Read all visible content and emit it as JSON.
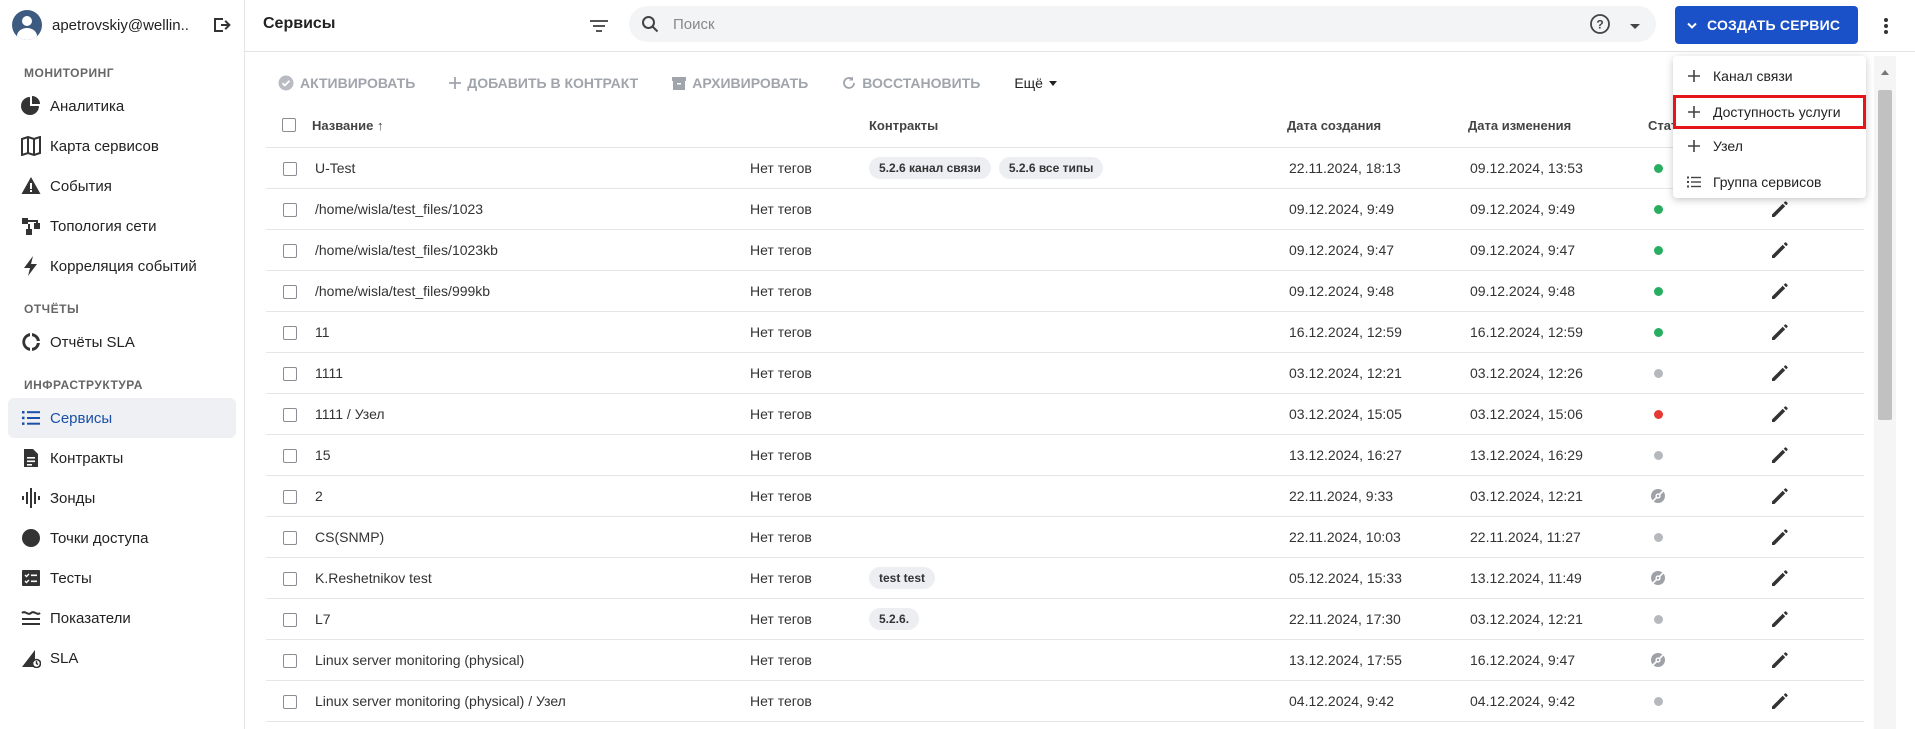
{
  "sidebar": {
    "user": "apetrovskiy@wellin...",
    "sections": [
      {
        "title": "МОНИТОРИНГ",
        "items": [
          {
            "label": "Аналитика",
            "icon": "pie-chart-icon"
          },
          {
            "label": "Карта сервисов",
            "icon": "map-icon"
          },
          {
            "label": "События",
            "icon": "warning-icon"
          },
          {
            "label": "Топология сети",
            "icon": "topology-icon"
          },
          {
            "label": "Корреляция событий",
            "icon": "lightning-icon"
          }
        ]
      },
      {
        "title": "ОТЧЁТЫ",
        "items": [
          {
            "label": "Отчёты SLA",
            "icon": "donut-icon"
          }
        ]
      },
      {
        "title": "ИНФРАСТРУКТУРА",
        "items": [
          {
            "label": "Сервисы",
            "icon": "list-icon",
            "active": true
          },
          {
            "label": "Контракты",
            "icon": "document-icon"
          },
          {
            "label": "Зонды",
            "icon": "sound-wave-icon"
          },
          {
            "label": "Точки доступа",
            "icon": "circle-icon"
          },
          {
            "label": "Тесты",
            "icon": "checklist-icon"
          },
          {
            "label": "Показатели",
            "icon": "metrics-icon"
          },
          {
            "label": "SLA",
            "icon": "sla-icon"
          }
        ]
      }
    ]
  },
  "header": {
    "title": "Сервисы",
    "search_placeholder": "Поиск",
    "create_button": "СОЗДАТЬ СЕРВИС"
  },
  "toolbar": {
    "activate": "АКТИВИРОВАТЬ",
    "add_to_contract": "ДОБАВИТЬ В КОНТРАКТ",
    "archive": "АРХИВИРОВАТЬ",
    "restore": "ВОССТАНОВИТЬ",
    "more": "Ещё"
  },
  "table": {
    "columns": {
      "name": "Название ↑",
      "contracts": "Контракты",
      "created": "Дата создания",
      "modified": "Дата изменения",
      "status": "Стат"
    },
    "rows": [
      {
        "name": "U-Test",
        "tags": "Нет тегов",
        "contracts": [
          "5.2.6 канал связи",
          "5.2.6 все типы"
        ],
        "created": "22.11.2024, 18:13",
        "modified": "09.12.2024, 13:53",
        "status": "green"
      },
      {
        "name": "/home/wisla/test_files/1023",
        "tags": "Нет тегов",
        "contracts": [],
        "created": "09.12.2024, 9:49",
        "modified": "09.12.2024, 9:49",
        "status": "green"
      },
      {
        "name": "/home/wisla/test_files/1023kb",
        "tags": "Нет тегов",
        "contracts": [],
        "created": "09.12.2024, 9:47",
        "modified": "09.12.2024, 9:47",
        "status": "green"
      },
      {
        "name": "/home/wisla/test_files/999kb",
        "tags": "Нет тегов",
        "contracts": [],
        "created": "09.12.2024, 9:48",
        "modified": "09.12.2024, 9:48",
        "status": "green"
      },
      {
        "name": "11",
        "tags": "Нет тегов",
        "contracts": [],
        "created": "16.12.2024, 12:59",
        "modified": "16.12.2024, 12:59",
        "status": "green"
      },
      {
        "name": "1111",
        "tags": "Нет тегов",
        "contracts": [],
        "created": "03.12.2024, 12:21",
        "modified": "03.12.2024, 12:26",
        "status": "gray"
      },
      {
        "name": "1111 / Узел",
        "tags": "Нет тегов",
        "contracts": [],
        "created": "03.12.2024, 15:05",
        "modified": "03.12.2024, 15:06",
        "status": "red"
      },
      {
        "name": "15",
        "tags": "Нет тегов",
        "contracts": [],
        "created": "13.12.2024, 16:27",
        "modified": "13.12.2024, 16:29",
        "status": "gray"
      },
      {
        "name": "2",
        "tags": "Нет тегов",
        "contracts": [],
        "created": "22.11.2024, 9:33",
        "modified": "03.12.2024, 12:21",
        "status": "off"
      },
      {
        "name": "CS(SNMP)",
        "tags": "Нет тегов",
        "contracts": [],
        "created": "22.11.2024, 10:03",
        "modified": "22.11.2024, 11:27",
        "status": "gray"
      },
      {
        "name": "K.Reshetnikov test",
        "tags": "Нет тегов",
        "contracts": [
          "test test"
        ],
        "created": "05.12.2024, 15:33",
        "modified": "13.12.2024, 11:49",
        "status": "off"
      },
      {
        "name": "L7",
        "tags": "Нет тегов",
        "contracts": [
          "5.2.6."
        ],
        "created": "22.11.2024, 17:30",
        "modified": "03.12.2024, 12:21",
        "status": "gray"
      },
      {
        "name": "Linux server monitoring (physical)",
        "tags": "Нет тегов",
        "contracts": [],
        "created": "13.12.2024, 17:55",
        "modified": "16.12.2024, 9:47",
        "status": "off"
      },
      {
        "name": "Linux server monitoring (physical) / Узел",
        "tags": "Нет тегов",
        "contracts": [],
        "created": "04.12.2024, 9:42",
        "modified": "04.12.2024, 9:42",
        "status": "gray"
      }
    ]
  },
  "menu": {
    "items": [
      {
        "label": "Канал связи",
        "icon": "plus-icon"
      },
      {
        "label": "Доступность услуги",
        "icon": "plus-icon",
        "highlighted": true
      },
      {
        "label": "Узел",
        "icon": "plus-icon"
      },
      {
        "label": "Группа сервисов",
        "icon": "list-icon"
      }
    ]
  },
  "colors": {
    "accent": "#1a50c8",
    "status_green": "#27ae60",
    "status_gray": "#b5b8bd",
    "status_red": "#e53935",
    "highlight": "#e4151b"
  }
}
